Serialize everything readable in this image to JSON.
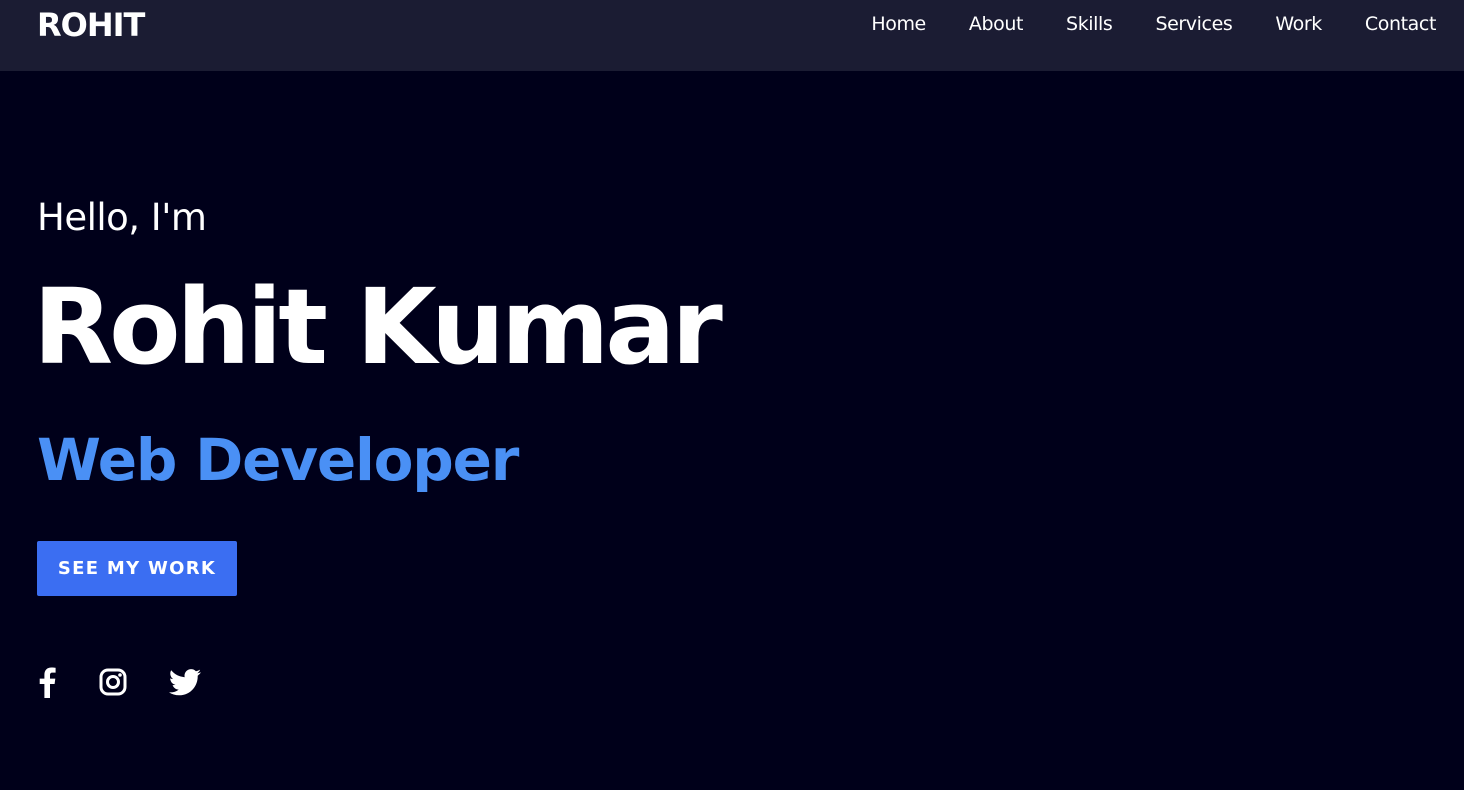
{
  "header": {
    "logo": "ROHIT",
    "nav": [
      {
        "label": "Home"
      },
      {
        "label": "About"
      },
      {
        "label": "Skills"
      },
      {
        "label": "Services"
      },
      {
        "label": "Work"
      },
      {
        "label": "Contact"
      }
    ]
  },
  "hero": {
    "greeting": "Hello, I'm",
    "name": "Rohit Kumar",
    "role": "Web Developer",
    "cta_label": "SEE MY WORK"
  },
  "socials": [
    {
      "icon": "facebook-icon"
    },
    {
      "icon": "instagram-icon"
    },
    {
      "icon": "twitter-icon"
    }
  ],
  "colors": {
    "background": "#00001a",
    "header": "#1b1c33",
    "accent": "#4a90f5",
    "button": "#3b6ef2",
    "text": "#ffffff"
  }
}
